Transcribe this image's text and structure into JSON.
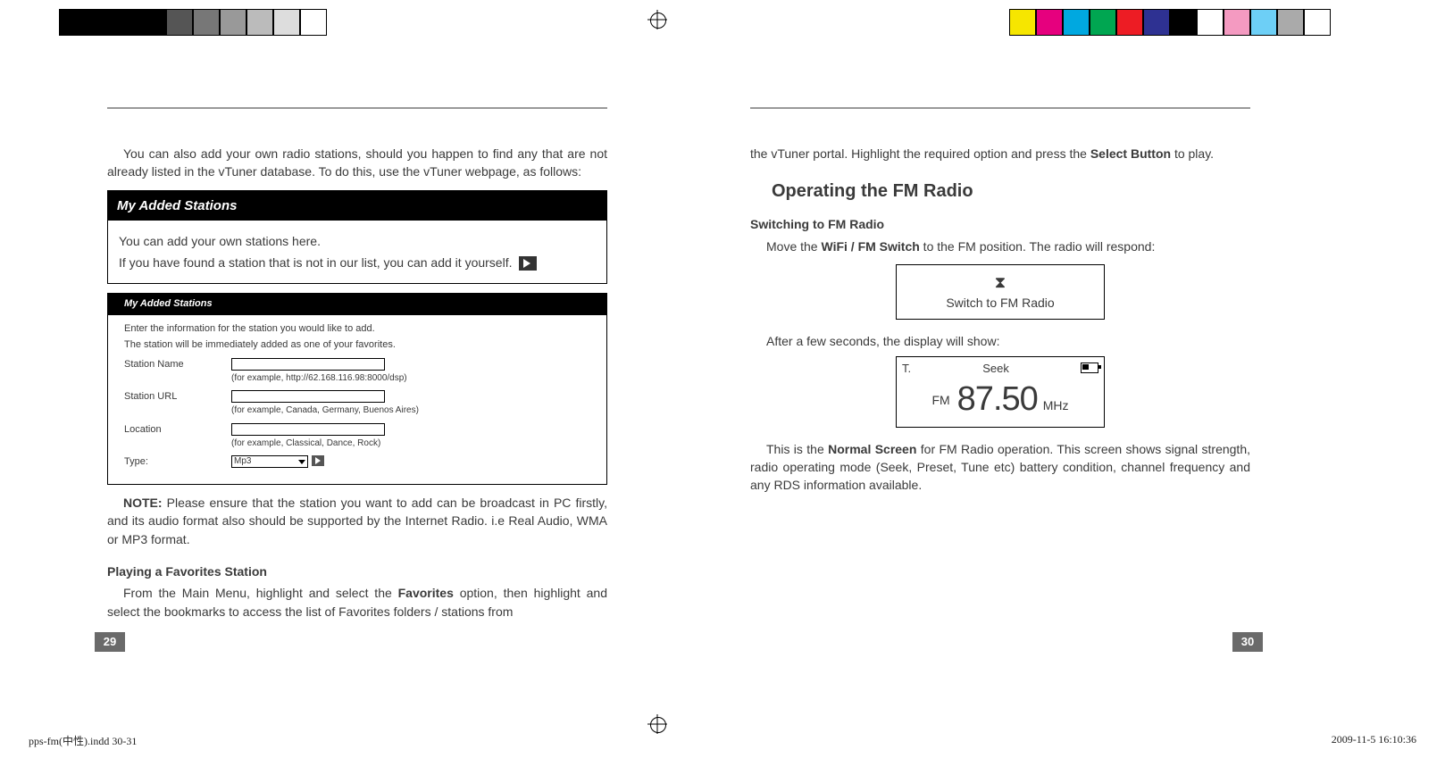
{
  "p29": {
    "intro1_full": "You can also add your own radio stations, should you happen to find any that are not already listed in the vTuner database. To do this, use the vTuner webpage, as follows:",
    "block1": {
      "title": "My Added Stations",
      "line1": "You can add your own stations here.",
      "line2": "If you have found a station that is not in our list, you can add it yourself."
    },
    "block2": {
      "title": "My Added Stations",
      "intro1": "Enter the information for the station you would like to add.",
      "intro2": "The station will be immediately added as one of your favorites.",
      "rows": {
        "name_label": "Station Name",
        "name_hint": "(for example, http://62.168.116.98:8000/dsp)",
        "url_label": "Station URL",
        "url_hint": "(for example, Canada, Germany, Buenos Aires)",
        "loc_label": "Location",
        "loc_hint": "(for example, Classical, Dance, Rock)",
        "type_label": "Type:",
        "type_value": "Mp3"
      }
    },
    "note_label": "NOTE:",
    "note_text": " Please ensure that the station you want to add can be broadcast in PC firstly, and its audio format also should be supported by the Internet Radio. i.e Real Audio, WMA or MP3 format.",
    "sub_play_title": "Playing a Favorites Station",
    "sub_play_pre": "From the Main Menu, highlight and select the ",
    "sub_play_bold": "Favorites",
    "sub_play_post": " option, then highlight and select the bookmarks to access the list of Favorites folders / stations from",
    "page_num": "29"
  },
  "p30": {
    "cont_pre": "the vTuner portal. Highlight the required option and press the ",
    "cont_bold": "Select Button",
    "cont_post": " to play.",
    "section_title": "Operating the FM Radio",
    "switch_sub": "Switching to FM Radio",
    "switch_pre": "Move the ",
    "switch_bold": "WiFi / FM Switch",
    "switch_post": " to the FM position. The radio will respond:",
    "lcd1_text": "Switch to FM Radio",
    "after_text": "After a few seconds, the display will show:",
    "lcd2": {
      "ant": "T.",
      "mode": "Seek",
      "fm": "FM",
      "freq": "87.50",
      "unit": "MHz"
    },
    "normal_pre": "This is the ",
    "normal_bold": "Normal Screen",
    "normal_post": " for FM Radio operation. This screen shows signal strength, radio operating mode (Seek, Preset, Tune etc) battery condition, channel frequency and any RDS information available.",
    "page_num": "30"
  },
  "footer": {
    "file": "pps-fm(中性).indd   30-31",
    "date": "2009-11-5   16:10:36"
  }
}
